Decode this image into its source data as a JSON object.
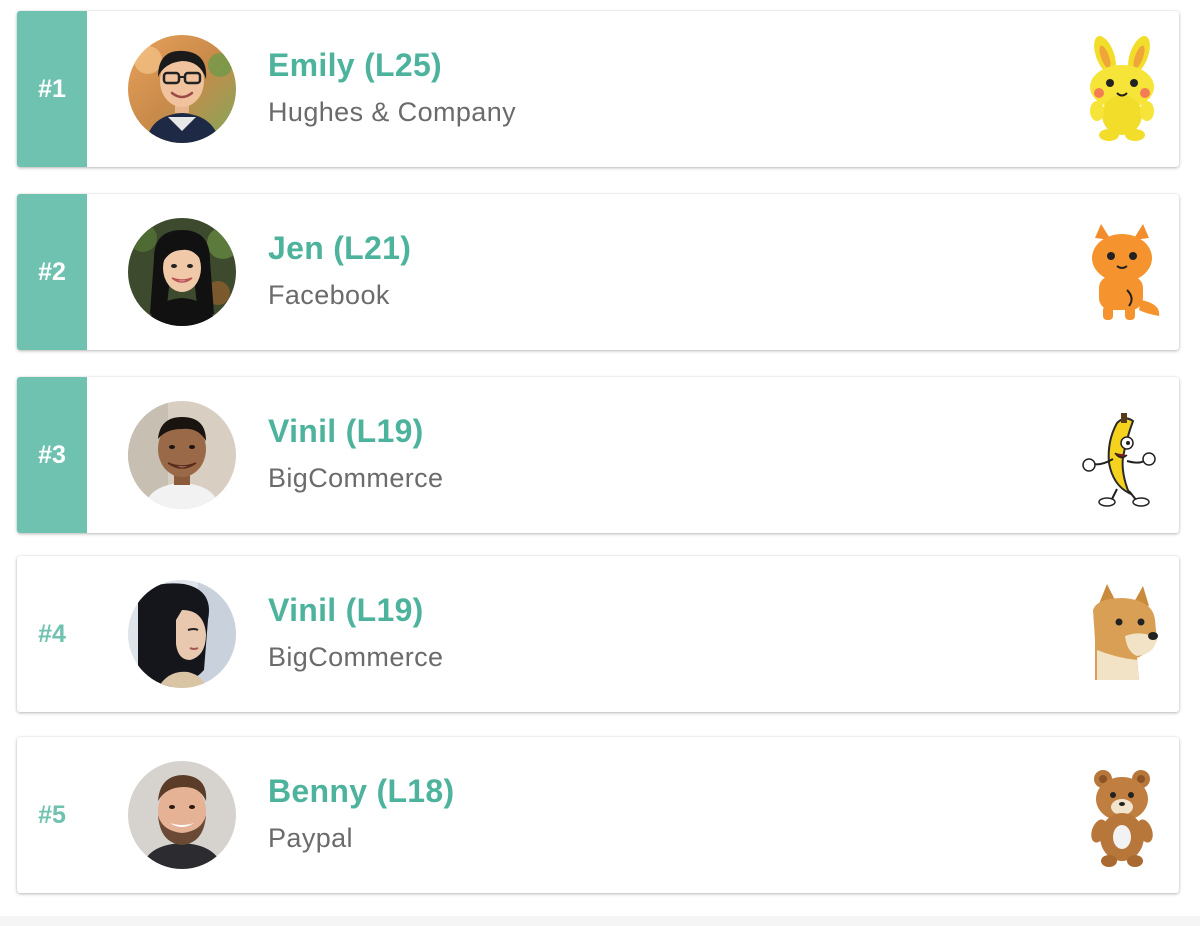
{
  "leaderboard": {
    "entries": [
      {
        "rank": "#1",
        "name": "Emily (L25)",
        "company": "Hughes & Company",
        "avatar": "avatar-emily",
        "sticker": "bunny-sticker-icon",
        "highlighted": true
      },
      {
        "rank": "#2",
        "name": "Jen (L21)",
        "company": "Facebook",
        "avatar": "avatar-jen",
        "sticker": "cat-sticker-icon",
        "highlighted": true
      },
      {
        "rank": "#3",
        "name": "Vinil (L19)",
        "company": "BigCommerce",
        "avatar": "avatar-vinil",
        "sticker": "banana-sticker-icon",
        "highlighted": true
      },
      {
        "rank": "#4",
        "name": "Vinil (L19)",
        "company": "BigCommerce",
        "avatar": "avatar-profile",
        "sticker": "doge-sticker-icon",
        "highlighted": false
      },
      {
        "rank": "#5",
        "name": "Benny (L18)",
        "company": "Paypal",
        "avatar": "avatar-benny",
        "sticker": "bear-sticker-icon",
        "highlighted": false
      }
    ]
  },
  "colors": {
    "accent": "#6fc2b0",
    "name_text": "#4db39c",
    "company_text": "#6b6b6b"
  }
}
